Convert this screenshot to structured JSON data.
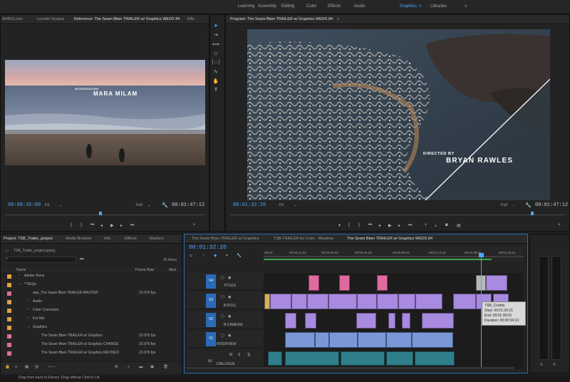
{
  "workspace": {
    "tabs": [
      "Learning",
      "Assembly",
      "Editing",
      "Color",
      "Effects",
      "Audio",
      "Graphics",
      "Libraries"
    ],
    "active": "Graphics",
    "more": "»"
  },
  "source": {
    "tabs": [
      "00402].mov",
      "Lumetri Scopes",
      "Reference: The Seam Btwn TRAILER w/ Graphics WEDS 84",
      "Effe"
    ],
    "overlay_small": "INTRODUCING",
    "overlay_big": "MARA MILAM",
    "timecode": "00:00:35:00",
    "fit": "Fit",
    "quality": "Full",
    "duration": "00:01:47:12"
  },
  "program": {
    "tab": "Program: The Seam Btwn TRAILER w/ Graphics WEDS 84",
    "overlay_small": "DIRECTED BY",
    "overlay_big": "BRYAN RAWLES",
    "timecode": "00:01:32:20",
    "fit": "Fit",
    "quality": "Full",
    "duration": "00:01:47:12"
  },
  "project": {
    "tabs": [
      "Project: TSB_Trailer_project",
      "Media Browser",
      "Info",
      "Effects",
      "Markers"
    ],
    "filename": "TSB_Trailer_project.prproj",
    "count": "35 Items",
    "col_name": "Name",
    "col_rate": "Frame Rate",
    "col_media": "Med",
    "rows": [
      {
        "name": "Adobe Stock",
        "rate": "",
        "color": "#e0a040",
        "indent": 0,
        "arrow": "›"
      },
      {
        "name": "**SEQs",
        "rate": "",
        "color": "#e0a040",
        "indent": 0,
        "arrow": "⌄"
      },
      {
        "name": "aaa_The Seam Btwn TRAILER MASTER",
        "rate": "23.976 fps",
        "color": "#e06aa0",
        "indent": 1,
        "arrow": ""
      },
      {
        "name": "Audio",
        "rate": "",
        "color": "#e0a040",
        "indent": 1,
        "arrow": "›"
      },
      {
        "name": "Color Correction",
        "rate": "",
        "color": "#e0a040",
        "indent": 1,
        "arrow": "›"
      },
      {
        "name": "For Mix",
        "rate": "",
        "color": "#e0a040",
        "indent": 1,
        "arrow": "›"
      },
      {
        "name": "Graphics",
        "rate": "",
        "color": "#e0a040",
        "indent": 1,
        "arrow": "⌄"
      },
      {
        "name": "The Seam Btwn TRAILER w/ Graphics",
        "rate": "23.976 fps",
        "color": "#e06aa0",
        "indent": 2,
        "arrow": ""
      },
      {
        "name": "The Seam Btwn TRAILER w/ Graphics CHANGE",
        "rate": "23.976 fps",
        "color": "#e06aa0",
        "indent": 2,
        "arrow": ""
      },
      {
        "name": "The Seam Btwn TRAILER w/ Graphics REVISED",
        "rate": "23.976 fps",
        "color": "#e06aa0",
        "indent": 2,
        "arrow": ""
      }
    ]
  },
  "timeline": {
    "tabs": [
      "The Seam Btwn TRAILER w/ Graphics",
      "TSB TRAILER for Color - Meadow",
      "The Seam Btwn TRAILER w/ Graphics WEDS 84"
    ],
    "timecode": "00:01:32:20",
    "ruler": [
      ":00:00",
      "00:00:14:23",
      "00:00:29:23",
      "00:00:44:22",
      "00:00:59:22",
      "00:01:14:22",
      "00:01:29:21",
      "00:01:44:21"
    ],
    "tracks": [
      {
        "id": "V4",
        "name": "TITLES"
      },
      {
        "id": "V3",
        "name": "B-ROLL"
      },
      {
        "id": "V2",
        "name": "B-CAMERA"
      },
      {
        "id": "V1",
        "name": "INTERVIEW"
      },
      {
        "id": "A1",
        "name": "DIALOGUE"
      }
    ],
    "tooltip": {
      "title": "TSB_Credits",
      "start": "Start: 00:01:30:15",
      "end": "End: 00:01:35:03",
      "duration": "Duration: 00:00:04:13"
    }
  },
  "meters": {
    "left": "S",
    "right": "S"
  },
  "status": "Drag from track to Extract. Drag without Cmd to Lift."
}
